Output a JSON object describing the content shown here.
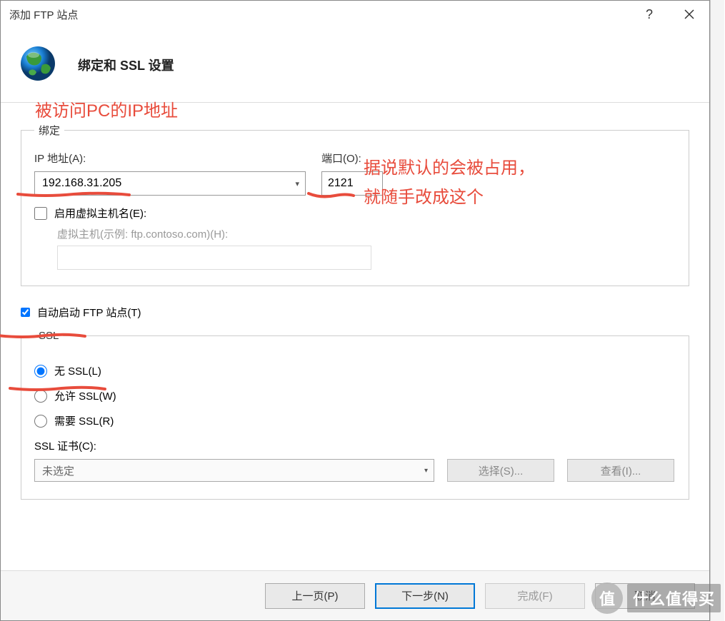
{
  "dialog": {
    "title": "添加 FTP 站点",
    "header_title": "绑定和 SSL 设置"
  },
  "binding": {
    "legend": "绑定",
    "ip_label": "IP 地址(A):",
    "ip_value": "192.168.31.205",
    "port_label": "端口(O):",
    "port_value": "2121",
    "enable_vhost_label": "启用虚拟主机名(E):",
    "enable_vhost_checked": false,
    "vhost_placeholder": "虚拟主机(示例: ftp.contoso.com)(H):"
  },
  "auto_start": {
    "label": "自动启动 FTP 站点(T)",
    "checked": true
  },
  "ssl": {
    "legend": "SSL",
    "no_ssl_label": "无 SSL(L)",
    "allow_ssl_label": "允许 SSL(W)",
    "require_ssl_label": "需要 SSL(R)",
    "selected": "no",
    "cert_label": "SSL 证书(C):",
    "cert_value": "未选定",
    "select_btn": "选择(S)...",
    "view_btn": "查看(I)..."
  },
  "footer": {
    "prev": "上一页(P)",
    "next": "下一步(N)",
    "finish": "完成(F)",
    "cancel": "取消"
  },
  "annotations": {
    "ip_note": "被访问PC的IP地址",
    "port_note_line1": "据说默认的会被占用，",
    "port_note_line2": "就随手改成这个"
  },
  "watermark": {
    "badge": "值",
    "text": "什么值得买"
  }
}
